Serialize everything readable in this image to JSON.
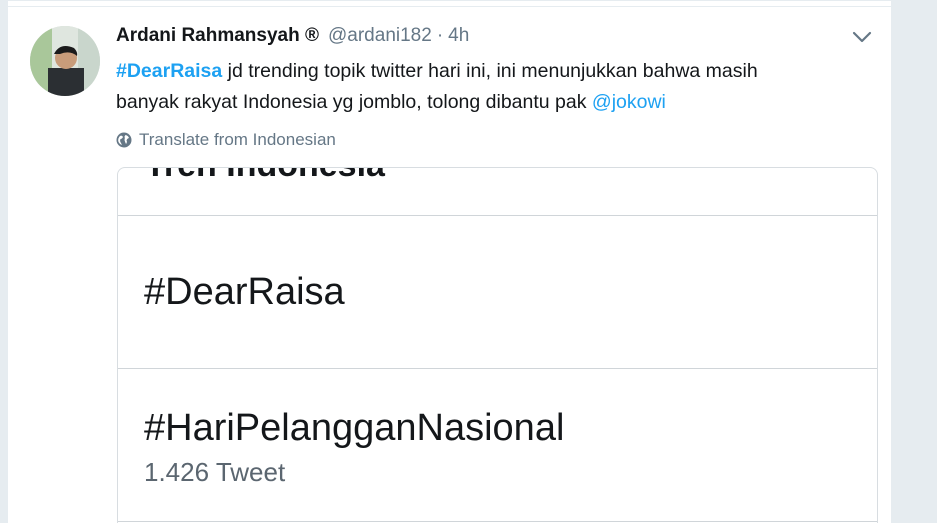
{
  "tweet": {
    "author_name": "Ardani Rahmansyah ®",
    "handle": "@ardani182",
    "separator": "·",
    "time": "4h",
    "text_hashtag": "#DearRaisa",
    "text_line1_rest": " jd trending topik twitter hari ini, ini menunjukkan bahwa masih",
    "text_line2": "banyak rakyat Indonesia yg jomblo, tolong dibantu pak ",
    "mention": "@jokowi",
    "translate_label": "Translate from Indonesian"
  },
  "media": {
    "header_text": "Tren Indonesia",
    "trends": [
      {
        "name": "#DearRaisa",
        "count": ""
      },
      {
        "name": "#HariPelangganNasional",
        "count": "1.426 Tweet"
      }
    ]
  },
  "colors": {
    "link": "#1da1f2",
    "muted": "#657786",
    "text": "#14171a",
    "page_bg": "#e6ecf0"
  },
  "icons": {
    "caret": "chevron-down-icon",
    "translate": "globe-icon"
  }
}
